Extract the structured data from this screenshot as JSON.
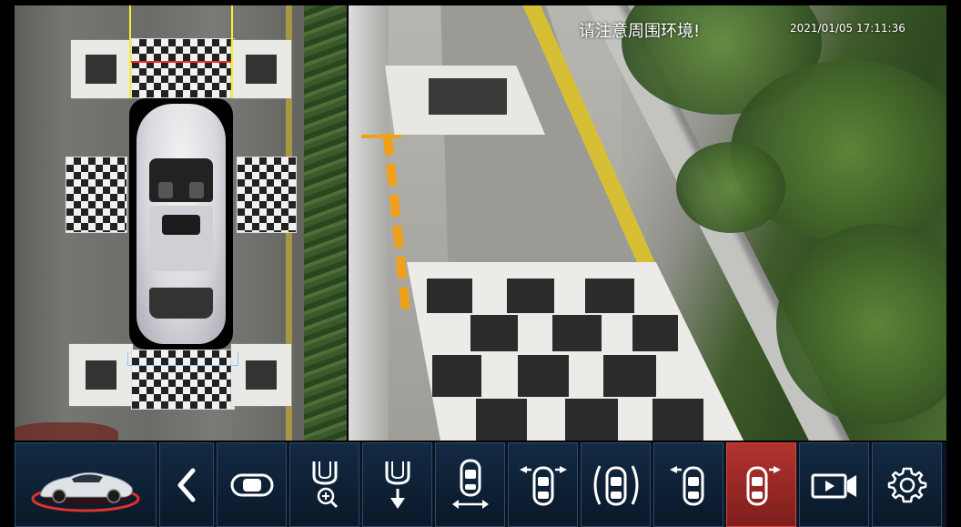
{
  "camera": {
    "warning_text": "请注意周围环境!",
    "timestamp": "2021/01/05  17:11:36"
  },
  "toolbar": {
    "buttons": [
      {
        "id": "vehicle",
        "icon": "car-model-icon"
      },
      {
        "id": "back",
        "icon": "chevron-left-icon"
      },
      {
        "id": "top-view",
        "icon": "car-top-view-icon"
      },
      {
        "id": "front-zoom",
        "icon": "front-zoom-icon"
      },
      {
        "id": "rear-view",
        "icon": "rear-down-icon"
      },
      {
        "id": "side-width",
        "icon": "car-width-icon"
      },
      {
        "id": "front-corners",
        "icon": "front-corners-icon"
      },
      {
        "id": "both-sides",
        "icon": "both-sides-icon"
      },
      {
        "id": "left-front",
        "icon": "left-front-icon"
      },
      {
        "id": "right-front",
        "icon": "right-front-icon",
        "active": true
      },
      {
        "id": "record",
        "icon": "video-record-icon"
      },
      {
        "id": "settings",
        "icon": "gear-icon"
      }
    ],
    "active_color": "#b3332e",
    "base_color": "#132a44"
  }
}
